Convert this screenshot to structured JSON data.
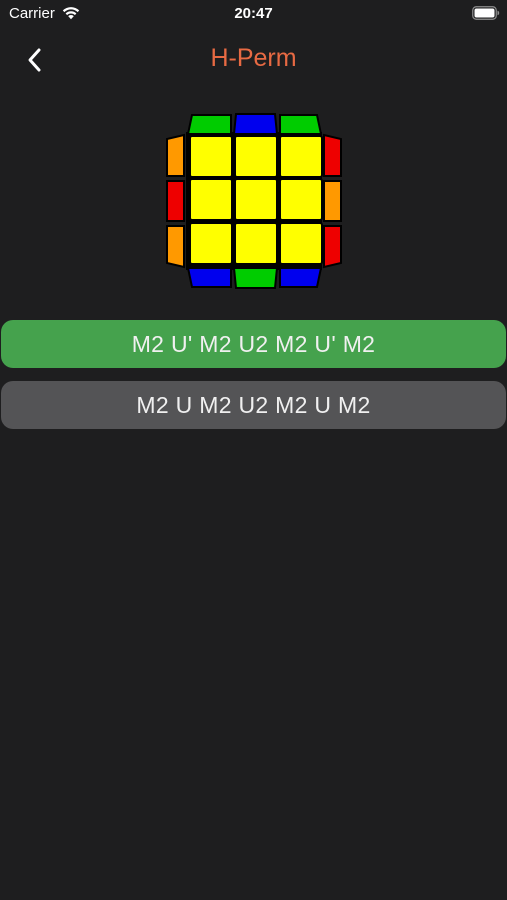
{
  "status_bar": {
    "carrier": "Carrier",
    "time": "20:47",
    "wifi_icon": "wifi-icon",
    "battery_icon": "battery-icon"
  },
  "nav": {
    "back_icon": "chevron-left-icon",
    "title": "H-Perm"
  },
  "colors": {
    "title": "#e86a43",
    "background": "#1e1e1f",
    "primary_button": "#45a24d",
    "secondary_button": "#545456",
    "yellow": "#ffff00",
    "green": "#00cc00",
    "blue": "#0000ee",
    "orange": "#ff9900",
    "red": "#ee0000"
  },
  "cube": {
    "top_edge": [
      "green",
      "blue",
      "green"
    ],
    "bottom_edge": [
      "blue",
      "green",
      "blue"
    ],
    "left_edge": [
      "orange",
      "red",
      "orange"
    ],
    "right_edge": [
      "red",
      "orange",
      "red"
    ],
    "face": [
      "yellow",
      "yellow",
      "yellow",
      "yellow",
      "yellow",
      "yellow",
      "yellow",
      "yellow",
      "yellow"
    ]
  },
  "algorithms": [
    {
      "label": "M2 U' M2 U2 M2 U' M2"
    },
    {
      "label": "M2 U M2 U2 M2 U M2"
    }
  ]
}
